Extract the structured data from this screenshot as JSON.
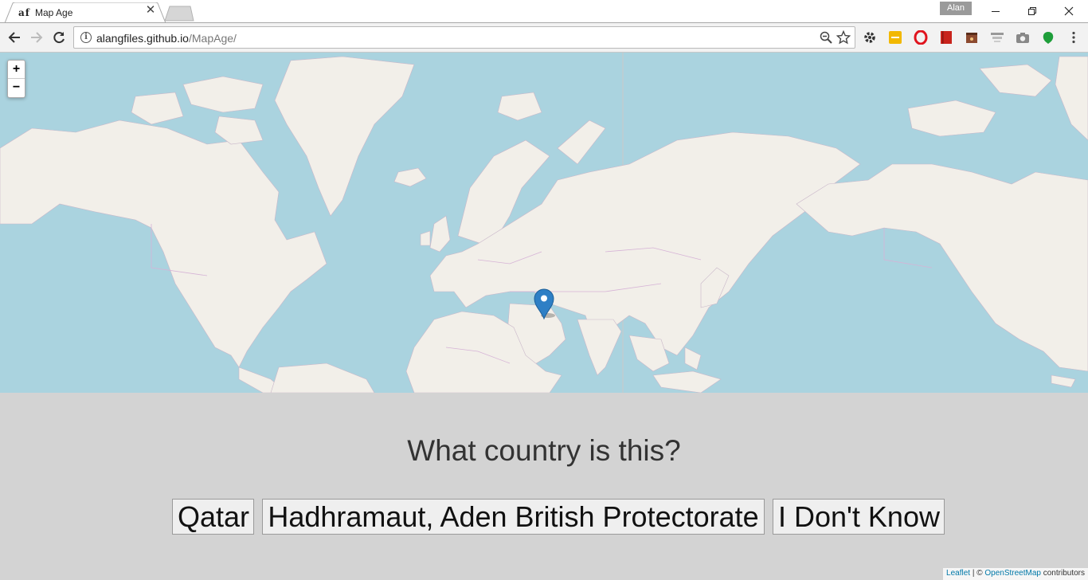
{
  "browser": {
    "tab": {
      "favicon_text": "af",
      "title": "Map Age",
      "close_glyph": "✕"
    },
    "profile_name": "Alan",
    "url": {
      "host": "alangfiles.github.io",
      "path": "/MapAge/"
    },
    "window_controls": [
      "minimize-icon",
      "restore-icon",
      "close-icon"
    ],
    "extensions": [
      "settings-extension-icon",
      "yellow-extension-icon",
      "opera-extension-icon",
      "red-book-extension-icon",
      "clapper-extension-icon",
      "screen-extension-icon",
      "camera-extension-icon",
      "green-leaf-extension-icon",
      "menu-icon"
    ]
  },
  "map": {
    "zoom_in_label": "+",
    "zoom_out_label": "−",
    "marker_color": "#2e7fc5",
    "land_color": "#f2efe9",
    "water_color": "#aad3df",
    "border_color": "#d6b3d6"
  },
  "quiz": {
    "question": "What country is this?",
    "answers": [
      "Qatar",
      "Hadhramaut, Aden British Protectorate",
      "I Don't Know"
    ]
  },
  "attribution": {
    "leaflet": "Leaflet",
    "separator": " | © ",
    "osm": "OpenStreetMap",
    "suffix": " contributors"
  }
}
